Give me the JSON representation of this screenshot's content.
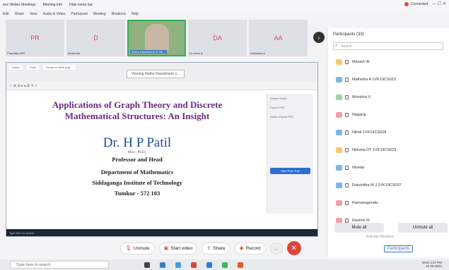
{
  "app_title": {
    "items": [
      "ece Webex Meetings",
      "Meeting Info",
      "Hide menu bar"
    ]
  },
  "connection": {
    "label": "Connected"
  },
  "menu": [
    "Edit",
    "Share",
    "View",
    "Audio & Video",
    "Participant",
    "Meeting",
    "Breakout",
    "Help"
  ],
  "strip": [
    {
      "initials": "PR",
      "name": "Prareddy ASR"
    },
    {
      "initials": "D",
      "name": "dividendo"
    },
    {
      "initials": "",
      "name": "Maths Department of Sid..."
    },
    {
      "initials": "DA",
      "name": "Dr. Ashe A"
    },
    {
      "initials": "AA",
      "name": "Abhilasha A"
    }
  ],
  "share": {
    "viewing": "Viewing Maths Department o...",
    "tabs": [
      "Home",
      "Tools",
      "Group on Web (48)..."
    ],
    "slide": {
      "title_line1": "Applications of Graph Theory and Discrete",
      "title_line2": "Mathematical Structures: An Insight",
      "author": "Dr. H P Patil",
      "degree": "M.sc., Ph.D.,",
      "role": "Professor and Head",
      "dept": "Department of Mathematics",
      "inst": "Siddaganga Institute of Technology",
      "city": "Tumkur - 572 103"
    },
    "side_panel": {
      "header": "Search Tools",
      "item1": "Export PDF",
      "item2": "Adobe Export PDF",
      "button": "Start Free Trial"
    },
    "inner_search": "Type here to search"
  },
  "controls": {
    "unmute": "Unmute",
    "video": "Start video",
    "share": "Share",
    "record": "Record",
    "more": "..."
  },
  "participants": {
    "header": "Participants (33)",
    "search_placeholder": "Search",
    "list": [
      {
        "name": "Manish W",
        "color": "#f3c96a"
      },
      {
        "name": "Mathisha A 1VK19CS023",
        "color": "#7ab8e8"
      },
      {
        "name": "Monisha V",
        "color": "#9cd6a0"
      },
      {
        "name": "Nagaraj",
        "color": "#f0a0a8"
      },
      {
        "name": "Nikhil 1VK19CS028",
        "color": "#7ab8e8"
      },
      {
        "name": "Nirksha DT 1VK19CS029",
        "color": "#f3c96a"
      },
      {
        "name": "Niveda",
        "color": "#7ab8e8"
      },
      {
        "name": "Rakshitha M J 1VK19CS037",
        "color": "#7ab8e8"
      },
      {
        "name": "Ramanagouda",
        "color": "#f0a0a8"
      },
      {
        "name": "Rashmi M",
        "color": "#f0a0a8"
      }
    ],
    "mute_all": "Mute all",
    "unmute_all": "Unmute all",
    "activate": "Activate Windows",
    "tab": "Participants"
  },
  "taskbar": {
    "search": "Type here to search",
    "time": "2:07 PM",
    "date": "11-05-2021",
    "lang": "ENG"
  }
}
